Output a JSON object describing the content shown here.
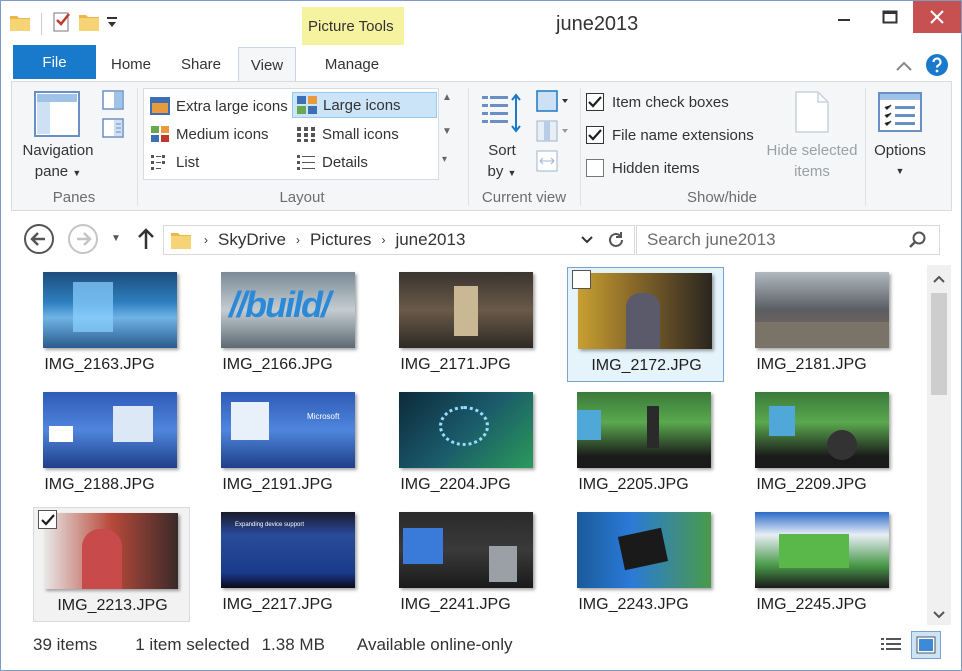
{
  "window": {
    "title": "june2013"
  },
  "ribbon_tabs": {
    "file": "File",
    "home": "Home",
    "share": "Share",
    "view": "View",
    "contextual_header": "Picture Tools",
    "manage": "Manage"
  },
  "panes_group": {
    "navigation_pane_line1": "Navigation",
    "navigation_pane_line2": "pane",
    "label": "Panes"
  },
  "layout_group": {
    "label": "Layout",
    "items": {
      "extra_large": "Extra large icons",
      "large": "Large icons",
      "medium": "Medium icons",
      "small": "Small icons",
      "list": "List",
      "details": "Details"
    },
    "selected": "Large icons"
  },
  "current_view_group": {
    "sort_line1": "Sort",
    "sort_line2": "by",
    "label": "Current view"
  },
  "show_hide_group": {
    "label": "Show/hide",
    "item_check_boxes": {
      "label": "Item check boxes",
      "checked": true
    },
    "file_name_extensions": {
      "label": "File name extensions",
      "checked": true
    },
    "hidden_items": {
      "label": "Hidden items",
      "checked": false
    },
    "hide_selected_line1": "Hide selected",
    "hide_selected_line2": "items"
  },
  "options_group": {
    "label": "Options"
  },
  "address": {
    "crumbs": [
      "SkyDrive",
      "Pictures",
      "june2013"
    ]
  },
  "search": {
    "placeholder": "Search june2013"
  },
  "files": [
    {
      "name": "IMG_2163.JPG"
    },
    {
      "name": "IMG_2166.JPG"
    },
    {
      "name": "IMG_2171.JPG"
    },
    {
      "name": "IMG_2172.JPG"
    },
    {
      "name": "IMG_2181.JPG"
    },
    {
      "name": "IMG_2188.JPG"
    },
    {
      "name": "IMG_2191.JPG"
    },
    {
      "name": "IMG_2204.JPG"
    },
    {
      "name": "IMG_2205.JPG"
    },
    {
      "name": "IMG_2209.JPG"
    },
    {
      "name": "IMG_2213.JPG"
    },
    {
      "name": "IMG_2217.JPG"
    },
    {
      "name": "IMG_2241.JPG"
    },
    {
      "name": "IMG_2243.JPG"
    },
    {
      "name": "IMG_2245.JPG"
    }
  ],
  "thumb_text": {
    "build": "//build/",
    "microsoft": "Microsoft",
    "slide_title": "Expanding device support"
  },
  "status": {
    "item_count": "39 items",
    "selection": "1 item selected",
    "size": "1.38 MB",
    "availability": "Available online-only"
  },
  "colors": {
    "accent": "#1979ca",
    "selection_bg": "#cce4f7",
    "context_tab": "#f5f2a0",
    "close_button": "#c75050"
  }
}
